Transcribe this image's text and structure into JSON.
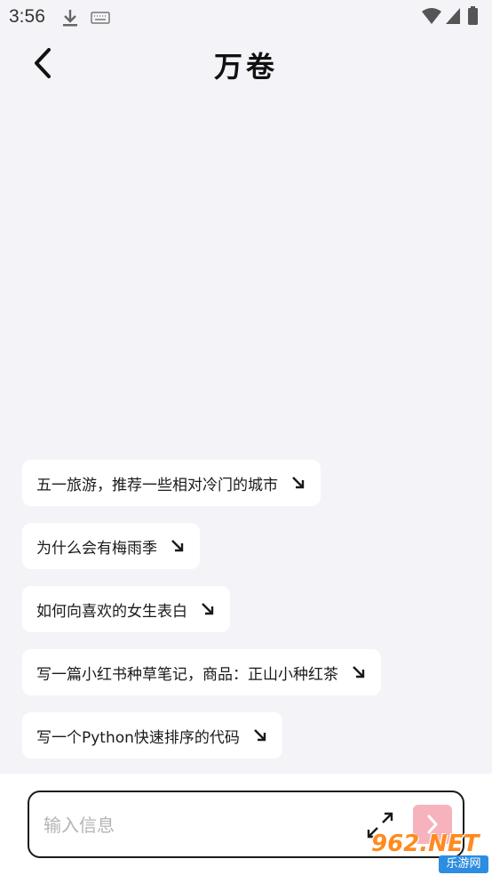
{
  "status_bar": {
    "time": "3:56",
    "left_icons": [
      "download-icon",
      "keyboard-icon"
    ],
    "right_icons": [
      "wifi-icon",
      "signal-icon",
      "battery-icon"
    ]
  },
  "header": {
    "title": "万卷",
    "back_icon": "chevron-left-icon"
  },
  "suggestions": [
    {
      "label": "五一旅游，推荐一些相对冷门的城市",
      "icon": "arrow-down-right-icon"
    },
    {
      "label": "为什么会有梅雨季",
      "icon": "arrow-down-right-icon"
    },
    {
      "label": "如何向喜欢的女生表白",
      "icon": "arrow-down-right-icon"
    },
    {
      "label": "写一篇小红书种草笔记，商品：正山小种红茶",
      "icon": "arrow-down-right-icon"
    },
    {
      "label": "写一个Python快速排序的代码",
      "icon": "arrow-down-right-icon"
    }
  ],
  "input_bar": {
    "value": "",
    "placeholder": "输入信息",
    "expand_icon": "expand-icon",
    "send_icon": "chevron-right-icon",
    "send_color": "#f7b3bd"
  },
  "watermark": {
    "top": "962.NET",
    "bottom": "乐游网"
  },
  "colors": {
    "background": "#f4f4f8",
    "chip": "#ffffff",
    "accent": "#f7b3bd"
  }
}
